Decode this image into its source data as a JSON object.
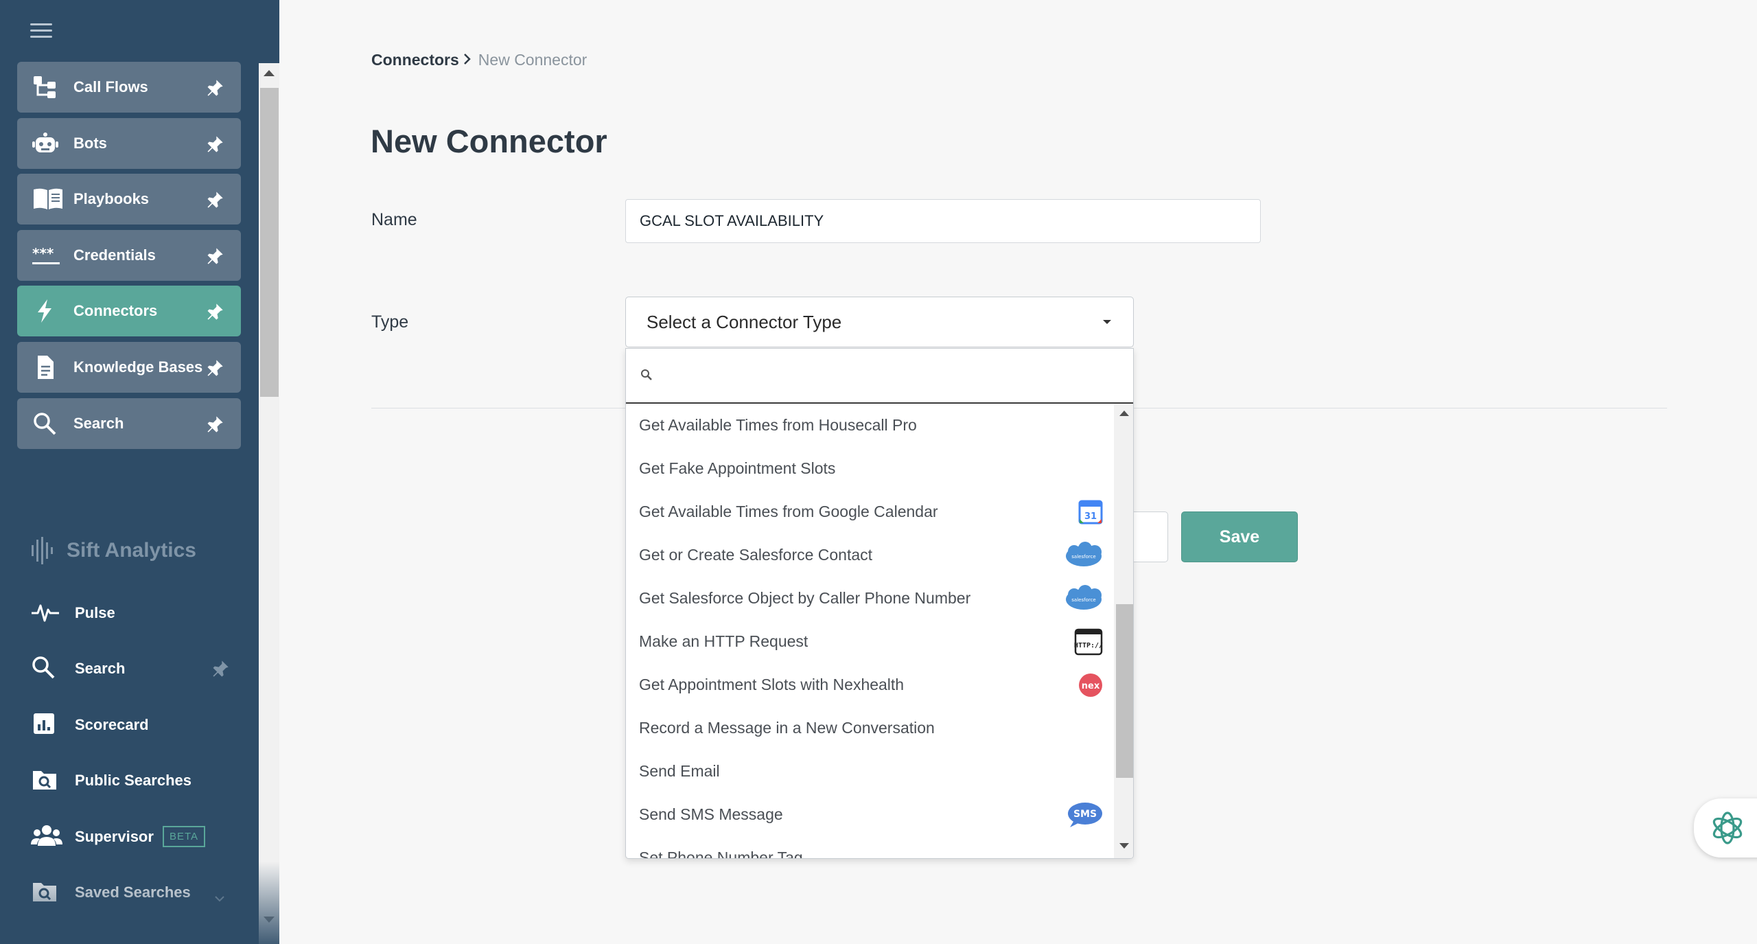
{
  "colors": {
    "sidebar_bg": "#2e4c67",
    "nav_button_bg": "#5f7488",
    "accent": "#5aa79a"
  },
  "sidebar": {
    "menu_icon": "hamburger-icon",
    "pinned_items": [
      {
        "label": "Call Flows",
        "icon": "call-flows-icon",
        "active": false
      },
      {
        "label": "Bots",
        "icon": "bot-icon",
        "active": false
      },
      {
        "label": "Playbooks",
        "icon": "book-icon",
        "active": false
      },
      {
        "label": "Credentials",
        "icon": "asterisks-icon",
        "active": false
      },
      {
        "label": "Connectors",
        "icon": "lightning-icon",
        "active": true
      },
      {
        "label": "Knowledge Bases",
        "icon": "document-icon",
        "active": false
      },
      {
        "label": "Search",
        "icon": "search-icon",
        "active": false
      }
    ],
    "analytics_title": "Sift Analytics",
    "analytics_items": [
      {
        "label": "Pulse",
        "icon": "pulse-icon"
      },
      {
        "label": "Search",
        "icon": "search-icon",
        "pinned": true
      },
      {
        "label": "Scorecard",
        "icon": "scorecard-icon"
      },
      {
        "label": "Public Searches",
        "icon": "folder-search-icon"
      },
      {
        "label": "Supervisor",
        "icon": "users-icon",
        "badge": "BETA"
      },
      {
        "label": "Saved Searches",
        "icon": "folder-search-icon",
        "expandable": true
      }
    ]
  },
  "breadcrumb": {
    "parent": "Connectors",
    "current": "New Connector"
  },
  "page": {
    "title": "New Connector"
  },
  "form": {
    "name_label": "Name",
    "name_value": "GCAL SLOT AVAILABILITY",
    "type_label": "Type",
    "type_placeholder": "Select a Connector Type",
    "save_label": "Save"
  },
  "dropdown": {
    "search_value": "",
    "options": [
      {
        "label": "Get Available Times from Housecall Pro",
        "icon": ""
      },
      {
        "label": "Get Fake Appointment Slots",
        "icon": ""
      },
      {
        "label": "Get Available Times from Google Calendar",
        "icon": "google-calendar-icon"
      },
      {
        "label": "Get or Create Salesforce Contact",
        "icon": "salesforce-icon"
      },
      {
        "label": "Get Salesforce Object by Caller Phone Number",
        "icon": "salesforce-icon"
      },
      {
        "label": "Make an HTTP Request",
        "icon": "http-icon"
      },
      {
        "label": "Get Appointment Slots with Nexhealth",
        "icon": "nexhealth-icon"
      },
      {
        "label": "Record a Message in a New Conversation",
        "icon": ""
      },
      {
        "label": "Send Email",
        "icon": ""
      },
      {
        "label": "Send SMS Message",
        "icon": "sms-icon"
      },
      {
        "label": "Set Phone Number Tag",
        "icon": ""
      }
    ],
    "icon_text": {
      "calendar": "31",
      "salesforce": "salesforce",
      "http": "HTTP://",
      "nexhealth": "nex",
      "sms": "SMS"
    }
  },
  "assistant": {
    "icon": "openai-logo-icon"
  }
}
